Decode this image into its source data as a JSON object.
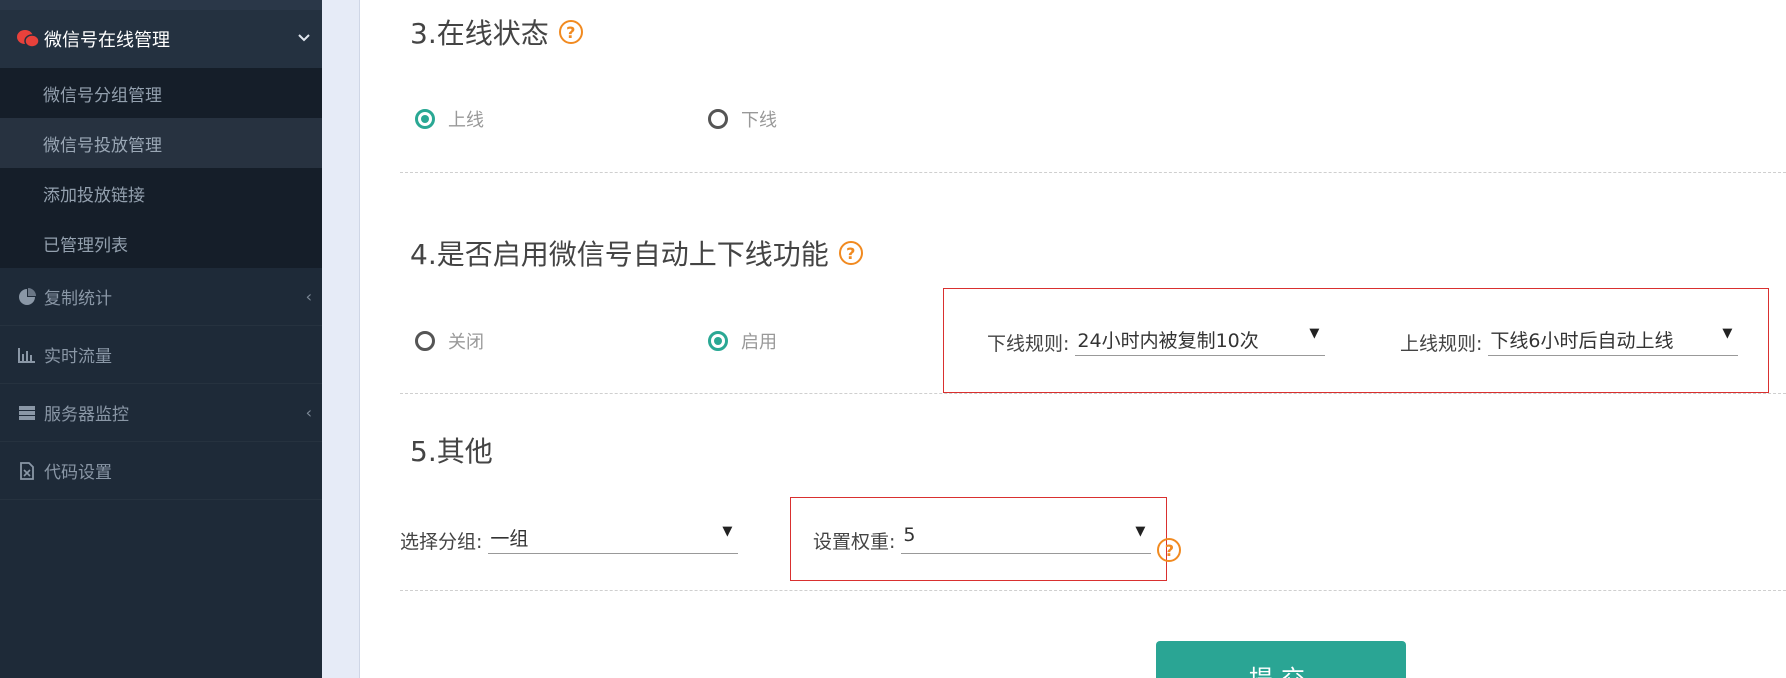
{
  "sidebar": {
    "group_title": "微信号在线管理",
    "sub_items": [
      "微信号分组管理",
      "微信号投放管理",
      "添加投放链接",
      "已管理列表"
    ],
    "nav_items": [
      {
        "label": "复制统计",
        "icon": "pie-chart-icon"
      },
      {
        "label": "实时流量",
        "icon": "bar-chart-icon"
      },
      {
        "label": "服务器监控",
        "icon": "server-icon"
      },
      {
        "label": "代码设置",
        "icon": "excel-file-icon"
      }
    ]
  },
  "section3": {
    "title": "3.在线状态",
    "options": [
      "上线",
      "下线"
    ],
    "selected": "上线"
  },
  "section4": {
    "title": "4.是否启用微信号自动上下线功能",
    "options": [
      "关闭",
      "启用"
    ],
    "selected": "启用",
    "offline_rule": {
      "label": "下线规则:",
      "value": "24小时内被复制10次"
    },
    "online_rule": {
      "label": "上线规则:",
      "value": "下线6小时后自动上线"
    }
  },
  "section5": {
    "title": "5.其他",
    "group": {
      "label": "选择分组:",
      "value": "一组"
    },
    "weight": {
      "label": "设置权重:",
      "value": "5"
    }
  },
  "help_glyph": "?",
  "caret_glyph": "▼",
  "submit_label": "提交",
  "colors": {
    "accent": "#2aa594",
    "help": "#f18a20",
    "highlight_border": "#d9302f"
  }
}
